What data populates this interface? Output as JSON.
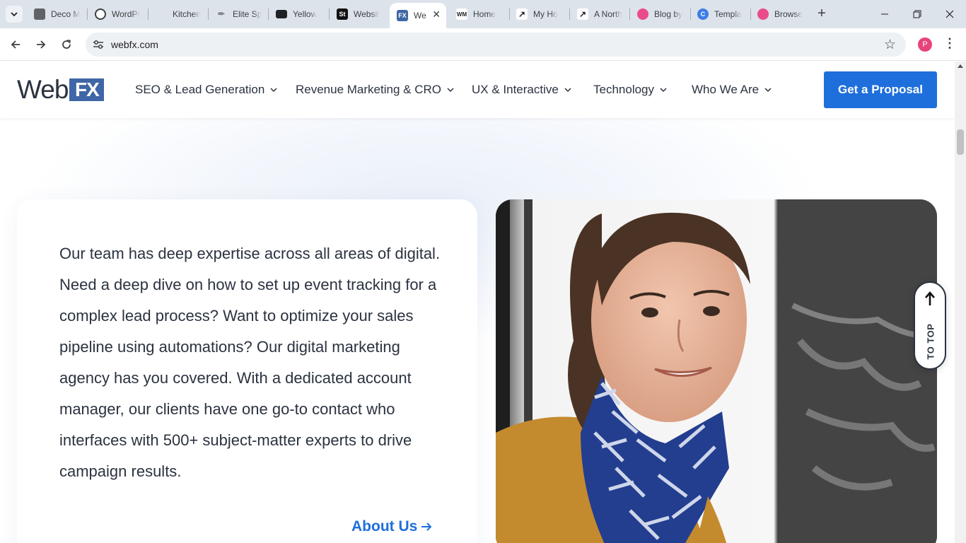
{
  "browser": {
    "tabs": [
      {
        "title": "Deco M",
        "icon": "deco-icon",
        "color": "#5f6368"
      },
      {
        "title": "WordPr",
        "icon": "wordpress-icon",
        "color": "#3c4043"
      },
      {
        "title": "Kitchen",
        "icon": "blank-page-icon",
        "color": "#dde3ea"
      },
      {
        "title": "Elite Sp",
        "icon": "feather-icon",
        "color": "#dde3ea"
      },
      {
        "title": "Yellow",
        "icon": "yellow-logo-icon",
        "color": "#202124"
      },
      {
        "title": "Websit",
        "icon": "st-icon",
        "color": "#111111"
      },
      {
        "title": "We",
        "icon": "webfx-icon",
        "color": "#3f66a6"
      },
      {
        "title": "Home",
        "icon": "wm-icon",
        "color": "#ffffff"
      },
      {
        "title": "My Ho",
        "icon": "link-icon",
        "color": "#ffffff"
      },
      {
        "title": "A North",
        "icon": "link-icon",
        "color": "#ffffff"
      },
      {
        "title": "Blog by",
        "icon": "dribbble-icon",
        "color": "#ea4c89"
      },
      {
        "title": "Templa",
        "icon": "canva-icon",
        "color": "#3d7de8"
      },
      {
        "title": "Browse",
        "icon": "dribbble-icon",
        "color": "#ea4c89"
      }
    ],
    "active_tab_index": 6,
    "url": "webfx.com",
    "profile_initial": "P"
  },
  "site": {
    "logo": {
      "text": "Web",
      "badge": "FX"
    },
    "nav": [
      {
        "label": "SEO & Lead Generation"
      },
      {
        "label": "Revenue Marketing & CRO"
      },
      {
        "label": "UX & Interactive"
      },
      {
        "label": "Technology"
      },
      {
        "label": "Who We Are"
      }
    ],
    "cta_label": "Get a Proposal",
    "body_text": "Our team has deep expertise across all areas of digital. Need a deep dive on how to set up event tracking for a complex lead process? Want to optimize your sales pipeline using automations? Our digital marketing agency has you covered. With a dedicated account manager, our clients have one go-to contact who interfaces with 500+ subject-matter experts to drive campaign results.",
    "about_link": "About Us",
    "to_top_label": "TO TOP"
  },
  "colors": {
    "brand_blue": "#1e6fdb",
    "logo_badge": "#3f66a6",
    "text_dark": "#2b3340"
  }
}
